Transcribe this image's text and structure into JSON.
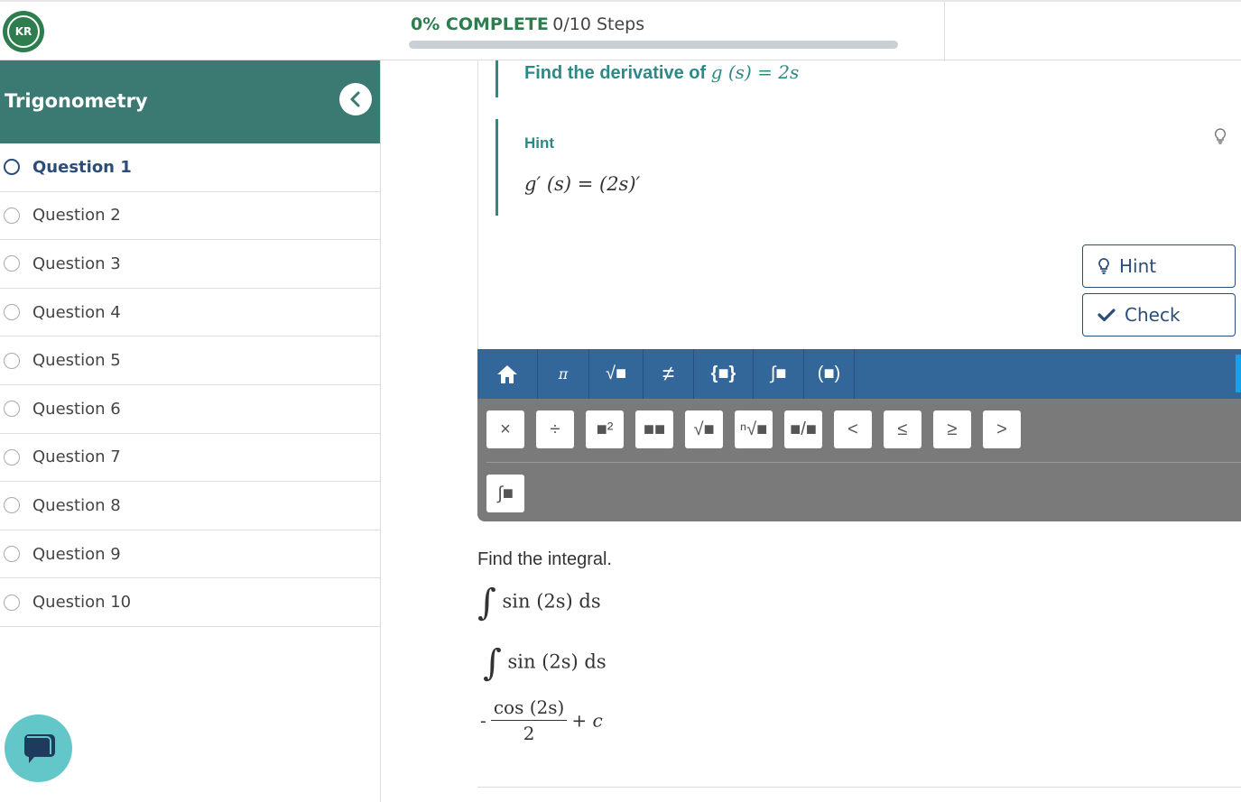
{
  "header": {
    "logo_text": "KR",
    "progress_percent": "0% COMPLETE",
    "progress_steps": "0/10 Steps",
    "progress_fraction": 0
  },
  "sidebar": {
    "title": "Trigonometry",
    "questions": [
      {
        "label": "Question 1",
        "active": true
      },
      {
        "label": "Question 2",
        "active": false
      },
      {
        "label": "Question 3",
        "active": false
      },
      {
        "label": "Question 4",
        "active": false
      },
      {
        "label": "Question 5",
        "active": false
      },
      {
        "label": "Question 6",
        "active": false
      },
      {
        "label": "Question 7",
        "active": false
      },
      {
        "label": "Question 8",
        "active": false
      },
      {
        "label": "Question 9",
        "active": false
      },
      {
        "label": "Question 10",
        "active": false
      }
    ]
  },
  "step": {
    "title_text": "Find the derivative of",
    "title_math": "g (s) = 2s",
    "hint_label": "Hint",
    "hint_formula": "g′ (s) = (2s)′"
  },
  "buttons": {
    "hint": "Hint",
    "check": "Check"
  },
  "keyboard": {
    "tabs": [
      "home-icon",
      "π",
      "√■",
      "≠",
      "{■}",
      "∫■",
      "(■)"
    ],
    "row1": [
      "×",
      "÷",
      "■²",
      "■■",
      "√■",
      "ⁿ√■",
      "■/■",
      "<",
      "≤",
      "≥",
      ">"
    ],
    "row2": [
      "∫■"
    ]
  },
  "integral": {
    "prompt": "Find the integral.",
    "expression": "sin (2s) ds",
    "answer_sign": "-",
    "answer_num": "cos (2s)",
    "answer_den": "2",
    "answer_const": "+ c"
  },
  "colors": {
    "brand_green": "#2e7d4f",
    "sidebar_header": "#3a7a73",
    "accent_teal": "#2c8a86",
    "keyboard_blue": "#33679a",
    "button_navy": "#2a4d7a"
  }
}
